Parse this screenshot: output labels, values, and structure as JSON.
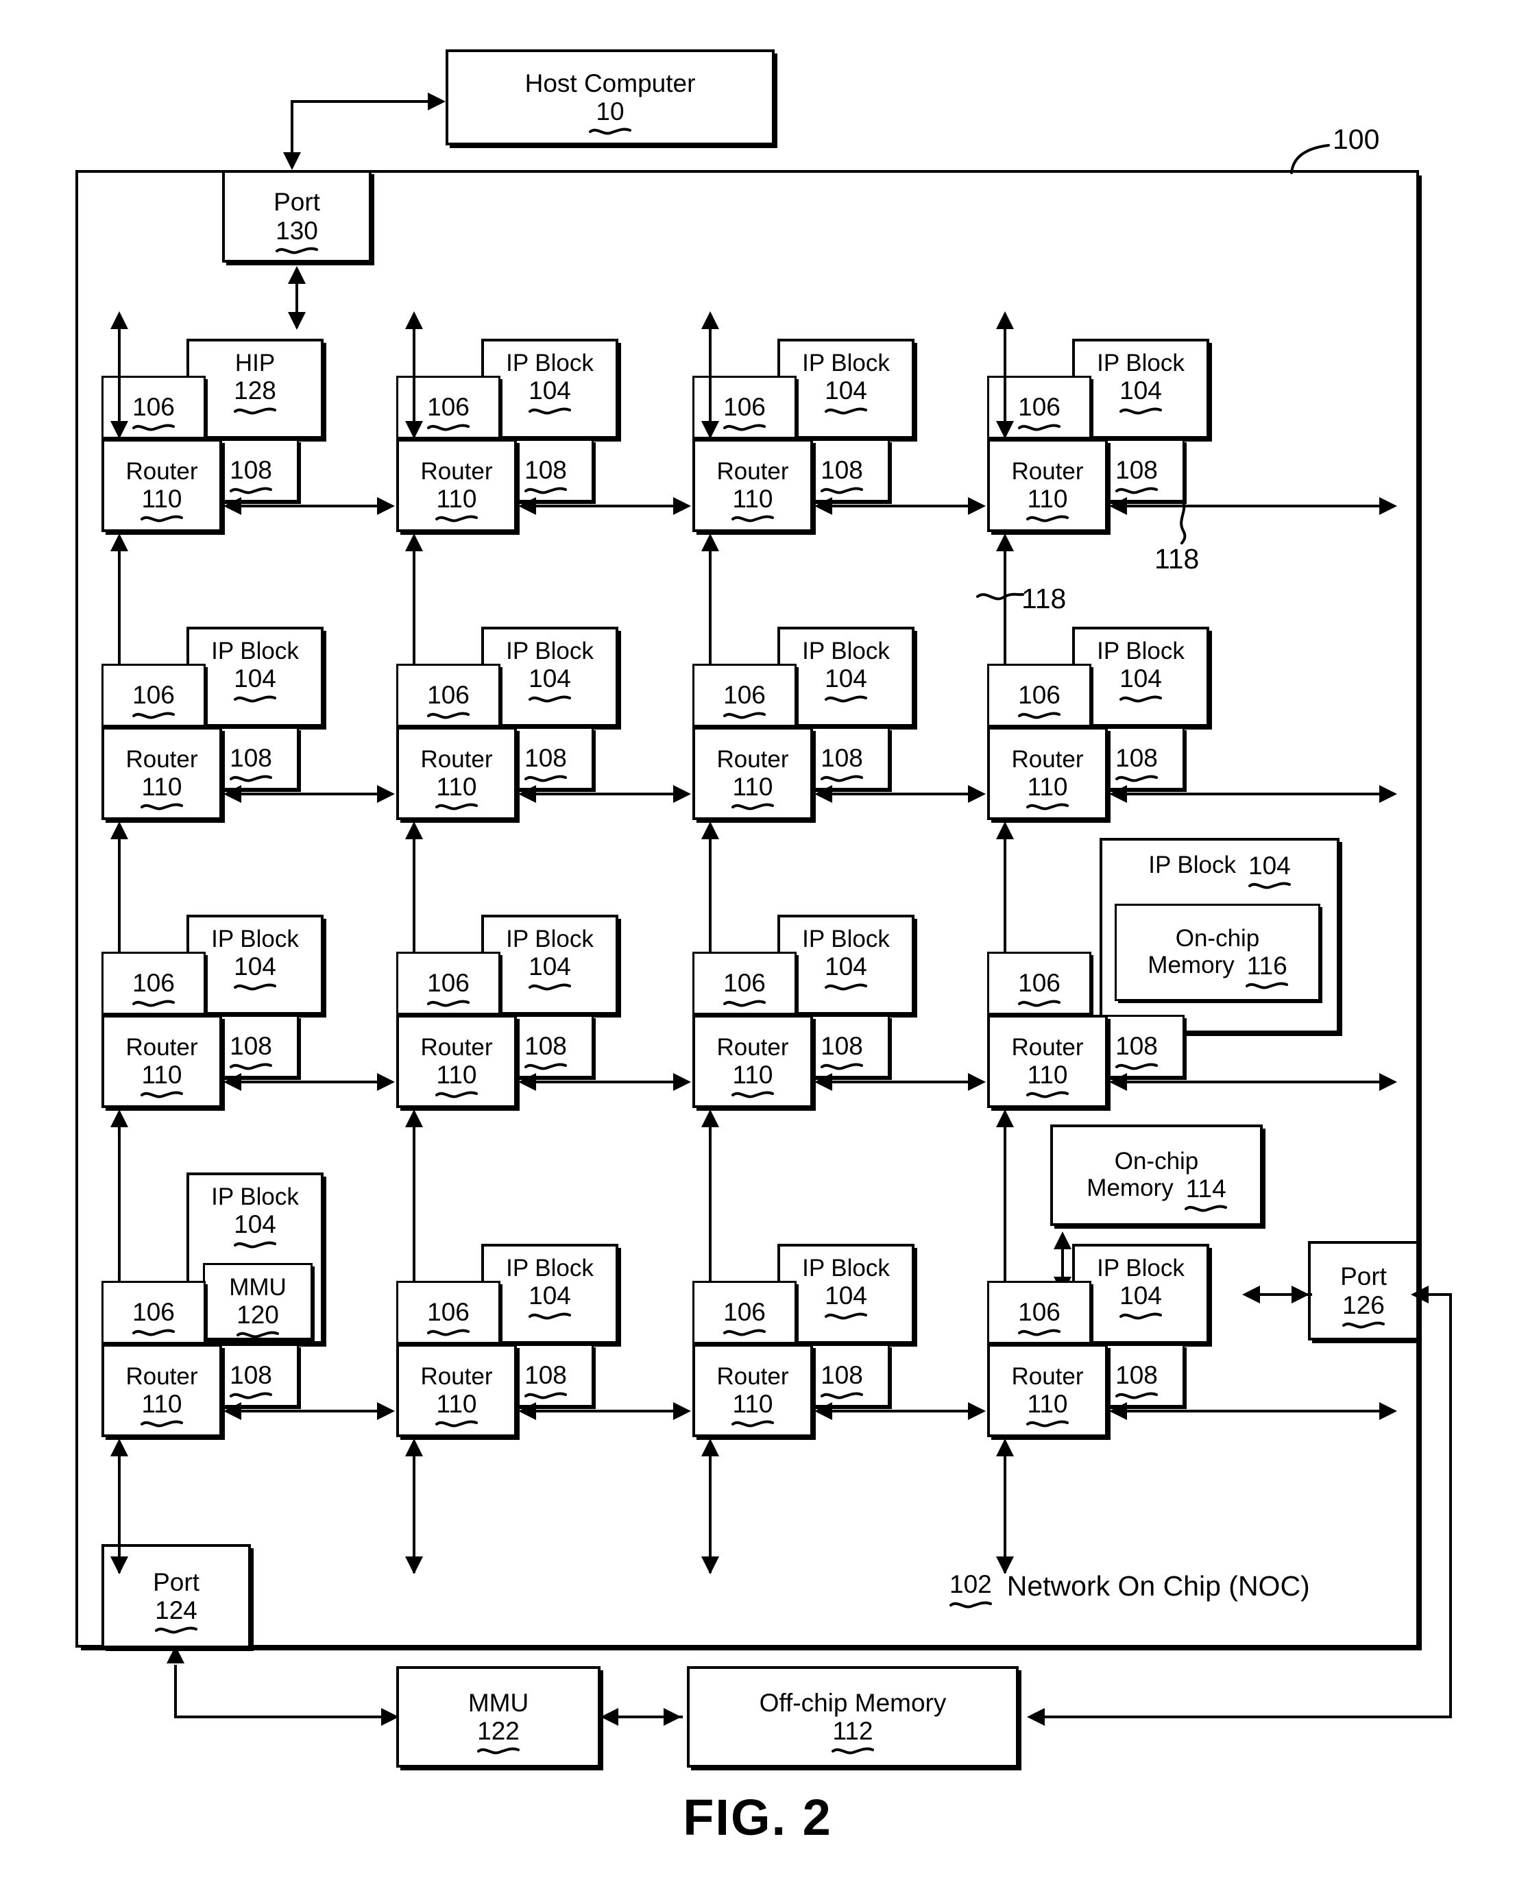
{
  "figure": {
    "caption": "FIG. 2",
    "system_ref": "100",
    "noc_label": "Network On Chip (NOC)",
    "noc_ref": "102"
  },
  "host": {
    "label": "Host Computer",
    "ref": "10"
  },
  "ports": {
    "top": {
      "label": "Port",
      "ref": "130"
    },
    "right": {
      "label": "Port",
      "ref": "126"
    },
    "bottom": {
      "label": "Port",
      "ref": "124"
    }
  },
  "node_parts": {
    "ip_block_label": "IP Block",
    "ip_block_ref": "104",
    "hip_label": "HIP",
    "hip_ref": "128",
    "adapter_ref": "106",
    "link_ref": "108",
    "router_label": "Router",
    "router_ref": "110"
  },
  "link_refs": {
    "horizontal": "118",
    "vertical": "118"
  },
  "memories": {
    "onchip_116": {
      "label_line1": "On-chip",
      "label_line2": "Memory",
      "ref": "116"
    },
    "onchip_114": {
      "label_line1": "On-chip",
      "label_line2": "Memory",
      "ref": "114"
    },
    "offchip_112": {
      "label": "Off-chip Memory",
      "ref": "112"
    }
  },
  "mmus": {
    "inner_120": {
      "label": "MMU",
      "ref": "120"
    },
    "external_122": {
      "label": "MMU",
      "ref": "122"
    }
  },
  "grid": {
    "rows": 4,
    "cols": 4,
    "nodes": [
      [
        {
          "block": "HIP",
          "block_ref": "128",
          "adapter": "106",
          "link": "108",
          "router": "Router",
          "router_ref": "110"
        },
        {
          "block": "IP Block",
          "block_ref": "104",
          "adapter": "106",
          "link": "108",
          "router": "Router",
          "router_ref": "110"
        },
        {
          "block": "IP Block",
          "block_ref": "104",
          "adapter": "106",
          "link": "108",
          "router": "Router",
          "router_ref": "110"
        },
        {
          "block": "IP Block",
          "block_ref": "104",
          "adapter": "106",
          "link": "108",
          "router": "Router",
          "router_ref": "110"
        }
      ],
      [
        {
          "block": "IP Block",
          "block_ref": "104",
          "adapter": "106",
          "link": "108",
          "router": "Router",
          "router_ref": "110"
        },
        {
          "block": "IP Block",
          "block_ref": "104",
          "adapter": "106",
          "link": "108",
          "router": "Router",
          "router_ref": "110"
        },
        {
          "block": "IP Block",
          "block_ref": "104",
          "adapter": "106",
          "link": "108",
          "router": "Router",
          "router_ref": "110"
        },
        {
          "block": "IP Block",
          "block_ref": "104",
          "adapter": "106",
          "link": "108",
          "router": "Router",
          "router_ref": "110"
        }
      ],
      [
        {
          "block": "IP Block",
          "block_ref": "104",
          "adapter": "106",
          "link": "108",
          "router": "Router",
          "router_ref": "110"
        },
        {
          "block": "IP Block",
          "block_ref": "104",
          "adapter": "106",
          "link": "108",
          "router": "Router",
          "router_ref": "110"
        },
        {
          "block": "IP Block",
          "block_ref": "104",
          "adapter": "106",
          "link": "108",
          "router": "Router",
          "router_ref": "110"
        },
        {
          "block": "IP Block",
          "block_ref": "104",
          "adapter": "106",
          "link": "108",
          "router": "Router",
          "router_ref": "110",
          "contains": "On-chip Memory 116"
        }
      ],
      [
        {
          "block": "IP Block",
          "block_ref": "104",
          "adapter": "106",
          "link": "108",
          "router": "Router",
          "router_ref": "110",
          "contains": "MMU 120"
        },
        {
          "block": "IP Block",
          "block_ref": "104",
          "adapter": "106",
          "link": "108",
          "router": "Router",
          "router_ref": "110"
        },
        {
          "block": "IP Block",
          "block_ref": "104",
          "adapter": "106",
          "link": "108",
          "router": "Router",
          "router_ref": "110"
        },
        {
          "block": "IP Block",
          "block_ref": "104",
          "adapter": "106",
          "link": "108",
          "router": "Router",
          "router_ref": "110"
        }
      ]
    ]
  }
}
